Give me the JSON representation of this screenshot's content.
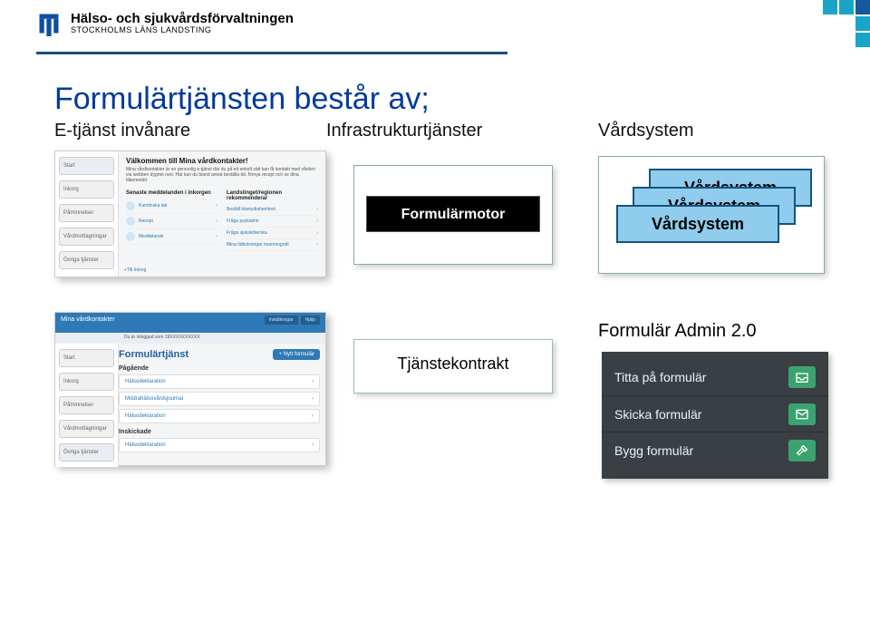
{
  "header": {
    "org_title": "Hälso- och sjukvårdsförvaltningen",
    "org_sub": "STOCKHOLMS LÄNS LANDSTING"
  },
  "slide": {
    "title": "Formulärtjänsten består av;",
    "columns": {
      "c1": "E-tjänst invånare",
      "c2": "Infrastrukturtjänster",
      "c3": "Vårdsystem"
    }
  },
  "mvk": {
    "heading": "Välkommen till Mina vårdkontakter!",
    "intro": "Mina vårdkontakter är en personlig e-tjänst där du på ett enkelt sätt kan få kontakt med vården via webben dygnet runt. Här kan du bland annat beställa tid, förnya recept och se dina läkemedel.",
    "side": [
      "Start",
      "Inkorg",
      "Påminnelser",
      "Vårdmottagningar",
      "Övriga tjänster"
    ],
    "col1_h": "Senaste meddelanden i inkorgen",
    "col1_items": [
      "Karolinska lab",
      "Recept",
      "Meddelande"
    ],
    "col2_h": "Landstinget/regionen rekommenderar",
    "col2_items": [
      "Beställ klamydiahemtest",
      "Fråga psykiatrin",
      "Fråga sjuksköterska",
      "Mina tidbokningar mammografi"
    ],
    "footer": "+Till Inkorg"
  },
  "diagram": {
    "formularmotor": "Formulärmotor",
    "stack_label": "Vårdsystem",
    "tjanstekontrakt": "Tjänstekontrakt"
  },
  "ft": {
    "topbar_logo": "Mina vårdkontakter",
    "topbar_btns": [
      "Inställningar",
      "Hjälp"
    ],
    "sub": "Du är inloggad som 19XXXXXXXXXX",
    "side": [
      "Start",
      "Inkorg",
      "Påminnelser",
      "Vårdmottagningar",
      "Övriga tjänster"
    ],
    "title": "Formulärtjänst",
    "new_btn": "+ Nytt formulär",
    "section1": "Pågående",
    "rows1": [
      "Hälsodeklaration",
      "Mödrahälsovårdsjournal",
      "Hälsodeklaration"
    ],
    "section2": "Inskickade",
    "rows2": [
      "Hälsodeklaration"
    ]
  },
  "admin": {
    "label": "Formulär Admin 2.0",
    "items": [
      {
        "label": "Titta på formulär",
        "icon": "tray"
      },
      {
        "label": "Skicka formulär",
        "icon": "mail"
      },
      {
        "label": "Bygg formulär",
        "icon": "hammer"
      }
    ]
  }
}
